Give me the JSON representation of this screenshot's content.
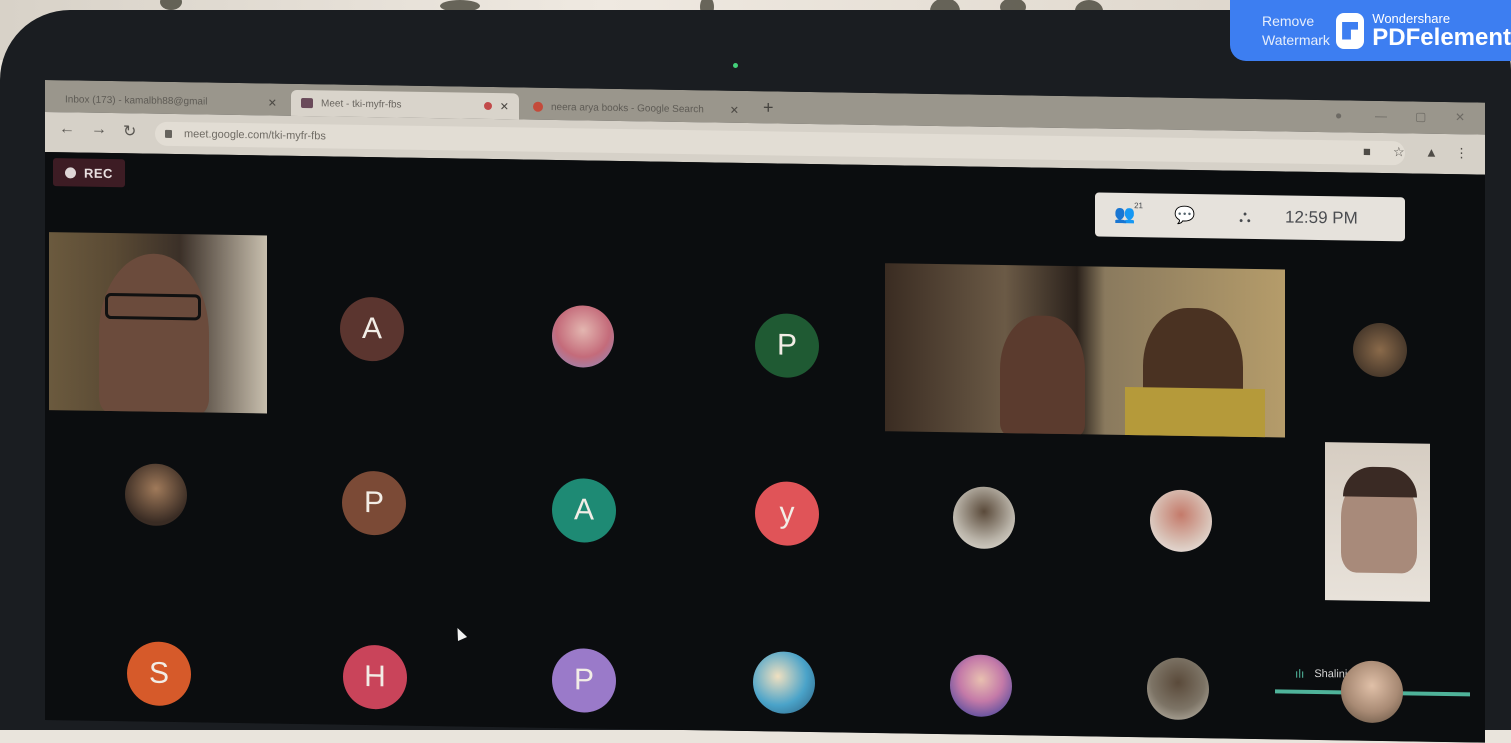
{
  "browser": {
    "tabs": [
      {
        "label": "Inbox (173) - kamalbh88@gmail"
      },
      {
        "label": "Meet - tki-myfr-fbs"
      },
      {
        "label": "neera arya books - Google Search"
      }
    ],
    "new_tab": "+",
    "url": "meet.google.com/tki-myfr-fbs"
  },
  "meet": {
    "rec_label": "REC",
    "participant_count": "21",
    "time": "12:59 PM",
    "active_speaker": "Shalini Awana"
  },
  "participants": [
    {
      "type": "video",
      "label": "",
      "color": "#3a3330"
    },
    {
      "type": "initial",
      "label": "A",
      "color": "#5b352f"
    },
    {
      "type": "photo",
      "label": "",
      "color": "#c46b7a"
    },
    {
      "type": "initial",
      "label": "P",
      "color": "#1f5a33"
    },
    {
      "type": "video",
      "label": "",
      "color": "#4a3a2c"
    },
    {
      "type": "photo",
      "label": "",
      "color": "#6a5a46"
    },
    {
      "type": "photo",
      "label": "",
      "color": "#7a5a44"
    },
    {
      "type": "initial",
      "label": "P",
      "color": "#7b4a36"
    },
    {
      "type": "initial",
      "label": "A",
      "color": "#1e8a74"
    },
    {
      "type": "initial",
      "label": "y",
      "color": "#e05458"
    },
    {
      "type": "photo",
      "label": "",
      "color": "#b9b3a8"
    },
    {
      "type": "photo",
      "label": "",
      "color": "#c9a39a"
    },
    {
      "type": "video",
      "label": "",
      "color": "#c9b2a2"
    },
    {
      "type": "initial",
      "label": "S",
      "color": "#d65a2a"
    },
    {
      "type": "initial",
      "label": "H",
      "color": "#c9445a"
    },
    {
      "type": "initial",
      "label": "P",
      "color": "#9a7ac9"
    },
    {
      "type": "photo",
      "label": "",
      "color": "#4aa3c9"
    },
    {
      "type": "photo",
      "label": "",
      "color": "#c47aa8"
    },
    {
      "type": "photo",
      "label": "",
      "color": "#7d7466"
    },
    {
      "type": "photo",
      "label": "",
      "color": "#a88a74"
    }
  ],
  "watermark": {
    "remove_line1": "Remove",
    "remove_line2": "Watermark",
    "brand_line1": "Wondershare",
    "brand_line2": "PDFelement"
  }
}
